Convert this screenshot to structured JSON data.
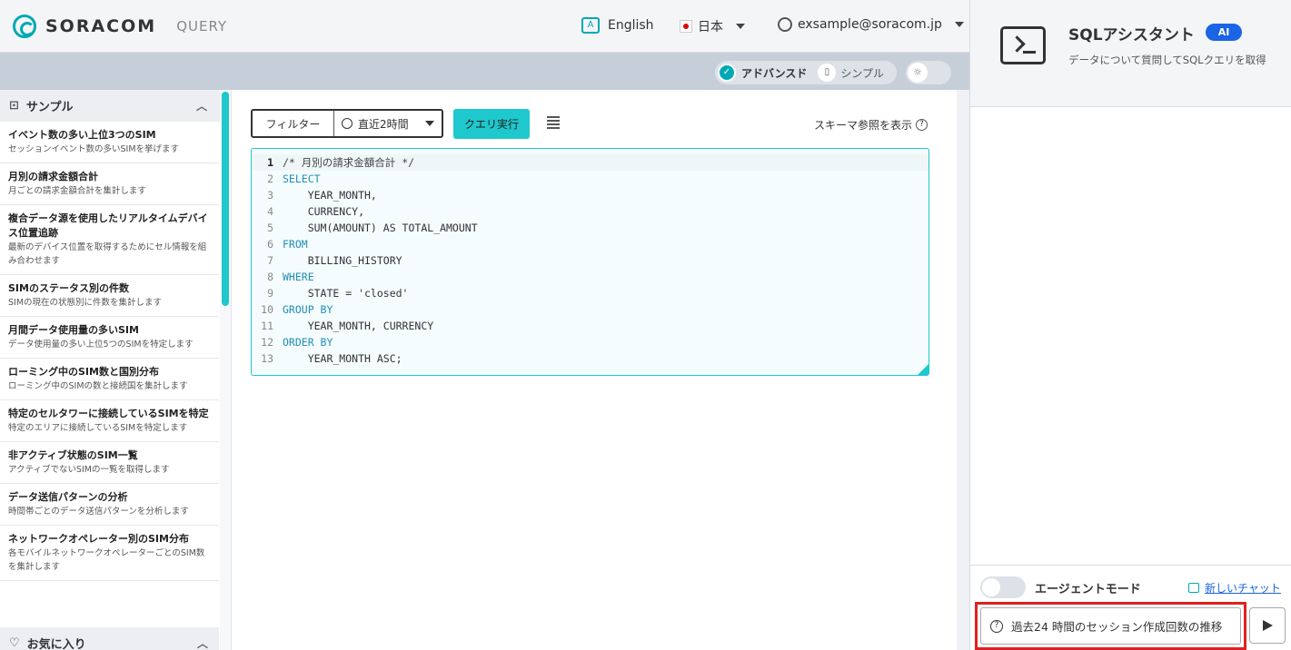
{
  "header": {
    "brand": "SORACOM",
    "product": "QUERY",
    "language": "English",
    "region": "日本",
    "user_email": "exsample@soracom.jp"
  },
  "modes": {
    "advanced": "アドバンスド",
    "simple": "シンプル"
  },
  "sidebar": {
    "section_title": "サンプル",
    "items": [
      {
        "title": "イベント数の多い上位3つのSIM",
        "desc": "セッションイベント数の多いSIMを挙げます"
      },
      {
        "title": "月別の請求金額合計",
        "desc": "月ごとの請求金額合計を集計します"
      },
      {
        "title": "複合データ源を使用したリアルタイムデバイス位置追跡",
        "desc": "最新のデバイス位置を取得するためにセル情報を組み合わせます"
      },
      {
        "title": "SIMのステータス別の件数",
        "desc": "SIMの現在の状態別に件数を集計します"
      },
      {
        "title": "月間データ使用量の多いSIM",
        "desc": "データ使用量の多い上位5つのSIMを特定します"
      },
      {
        "title": "ローミング中のSIM数と国別分布",
        "desc": "ローミング中のSIMの数と接続国を集計します"
      },
      {
        "title": "特定のセルタワーに接続しているSIMを特定",
        "desc": "特定のエリアに接続しているSIMを特定します"
      },
      {
        "title": "非アクティブ状態のSIM一覧",
        "desc": "アクティブでないSIMの一覧を取得します"
      },
      {
        "title": "データ送信パターンの分析",
        "desc": "時間帯ごとのデータ送信パターンを分析します"
      },
      {
        "title": "ネットワークオペレーター別のSIM分布",
        "desc": "各モバイルネットワークオペレーターごとのSIM数を集計します"
      }
    ],
    "favorites_title": "お気に入り"
  },
  "toolbar": {
    "filter_label": "フィルター",
    "time_range": "直近2時間",
    "run_label": "クエリ実行",
    "schema_label": "スキーマ参照を表示"
  },
  "editor": {
    "lines": [
      "/* 月別の請求金額合計 */",
      "SELECT",
      "    YEAR_MONTH,",
      "    CURRENCY,",
      "    SUM(AMOUNT) AS TOTAL_AMOUNT",
      "FROM",
      "    BILLING_HISTORY",
      "WHERE",
      "    STATE = 'closed'",
      "GROUP BY",
      "    YEAR_MONTH, CURRENCY",
      "ORDER BY",
      "    YEAR_MONTH ASC;"
    ]
  },
  "assistant": {
    "title": "SQLアシスタント",
    "badge": "AI",
    "description": "データについて質問してSQLクエリを取得",
    "agent_mode_label": "エージェントモード",
    "new_chat_label": "新しいチャット",
    "input_value": "過去24 時間のセッション作成回数の推移"
  }
}
